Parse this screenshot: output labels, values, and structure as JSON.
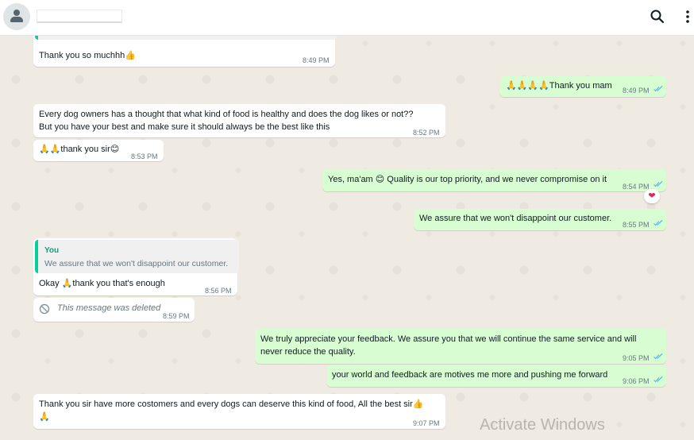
{
  "header": {
    "contact_name": "",
    "search_icon": "search-icon",
    "menu_icon": "more-vertical-icon"
  },
  "messages": [
    {
      "dir": "in",
      "text": "Thank you so muchhh👍",
      "time": "8:49 PM"
    },
    {
      "dir": "out",
      "text": "🙏🙏🙏🙏Thank you mam",
      "time": "8:49 PM"
    },
    {
      "dir": "in",
      "text": "Every dog owners has a thought that what kind of food is healthy and does the dog likes or not??",
      "text2": "But you have your best and make sure it should always be the best like this",
      "time": "8:52 PM"
    },
    {
      "dir": "in",
      "text": "🙏🙏thank you sir😊",
      "time": "8:53 PM"
    },
    {
      "dir": "out",
      "text": "Yes, ma'am 😊 Quality is our top priority, and we never compromise on it",
      "time": "8:54 PM",
      "reaction": "❤"
    },
    {
      "dir": "out",
      "text": "We assure that we won't disappoint our customer.",
      "time": "8:55 PM"
    },
    {
      "dir": "in",
      "quote_author": "You",
      "quote_text": "We assure that we won't disappoint our customer.",
      "text": "Okay 🙏thank you that's enough",
      "time": "8:56 PM"
    },
    {
      "dir": "in",
      "text": "This message was deleted",
      "time": "8:59 PM",
      "deleted": true
    },
    {
      "dir": "out",
      "text": "We truly appreciate your feedback. We assure you that we will continue the same service and will",
      "text2": "never reduce the quality.",
      "time": "9:05 PM"
    },
    {
      "dir": "out",
      "text": "your world and feedback are motives me more and pushing me forward",
      "time": "9:06 PM"
    },
    {
      "dir": "in",
      "text": "Thank you sir have more costomers and every dogs can deserve this kind of food, All the best sir👍",
      "text2": "🙏",
      "time": "9:07 PM"
    }
  ],
  "watermark": {
    "line1": "Activate Windows"
  },
  "colors": {
    "incoming": "#ffffff",
    "outgoing": "#d9fdd3",
    "read_ticks": "#53bdeb",
    "quote_bar": "#06cf9c"
  }
}
